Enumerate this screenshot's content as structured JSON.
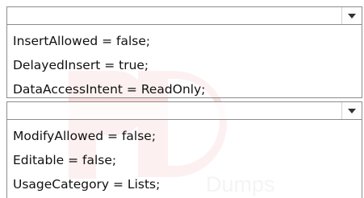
{
  "watermark": {
    "text": "PD",
    "subtext": "Dumps",
    "color": "#e84a4a"
  },
  "top_panel": {
    "combo_value": "",
    "lines": [
      "InsertAllowed = false;",
      "DelayedInsert = true;",
      "DataAccessIntent = ReadOnly;"
    ]
  },
  "bottom_panel": {
    "combo_value": "",
    "lines": [
      "ModifyAllowed = false;",
      "Editable = false;",
      "UsageCategory = Lists;"
    ]
  },
  "icons": {
    "dropdown": "chevron-down-icon"
  }
}
